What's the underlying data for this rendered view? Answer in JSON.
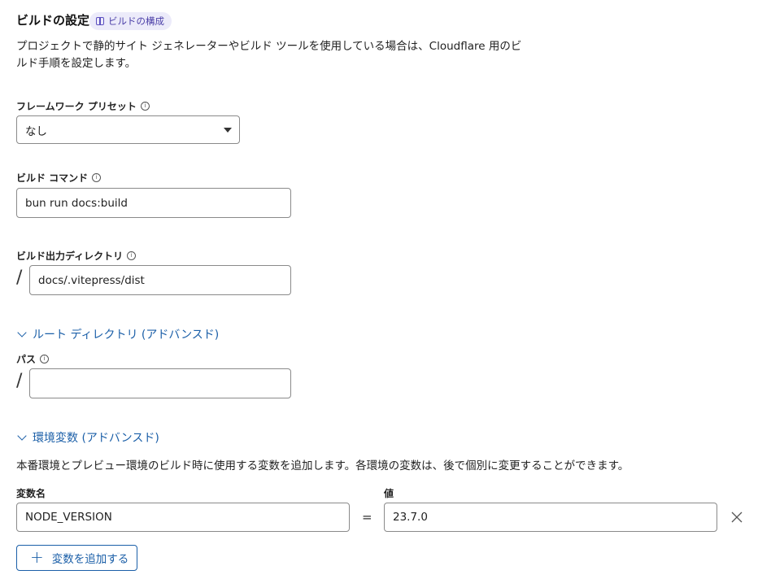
{
  "header": {
    "title": "ビルドの設定",
    "badge_label": "ビルドの構成",
    "description": "プロジェクトで静的サイト ジェネレーターやビルド ツールを使用している場合は、Cloudflare 用のビルド手順を設定します。"
  },
  "framework_preset": {
    "label": "フレームワーク プリセット",
    "selected": "なし"
  },
  "build_command": {
    "label": "ビルド コマンド",
    "value": "bun run docs:build"
  },
  "build_output": {
    "label": "ビルド出力ディレクトリ",
    "prefix": "/",
    "value": "docs/.vitepress/dist"
  },
  "root_directory": {
    "toggle_label": "ルート ディレクトリ (アドバンスド)",
    "path_label": "パス",
    "prefix": "/",
    "value": ""
  },
  "env_vars": {
    "toggle_label": "環境変数 (アドバンスド)",
    "description": "本番環境とプレビュー環境のビルド時に使用する変数を追加します。各環境の変数は、後で個別に変更することができます。",
    "name_header": "変数名",
    "value_header": "値",
    "equals": "=",
    "rows": [
      {
        "name": "NODE_VERSION",
        "value": "23.7.0"
      }
    ],
    "add_label": "変数を追加する"
  }
}
